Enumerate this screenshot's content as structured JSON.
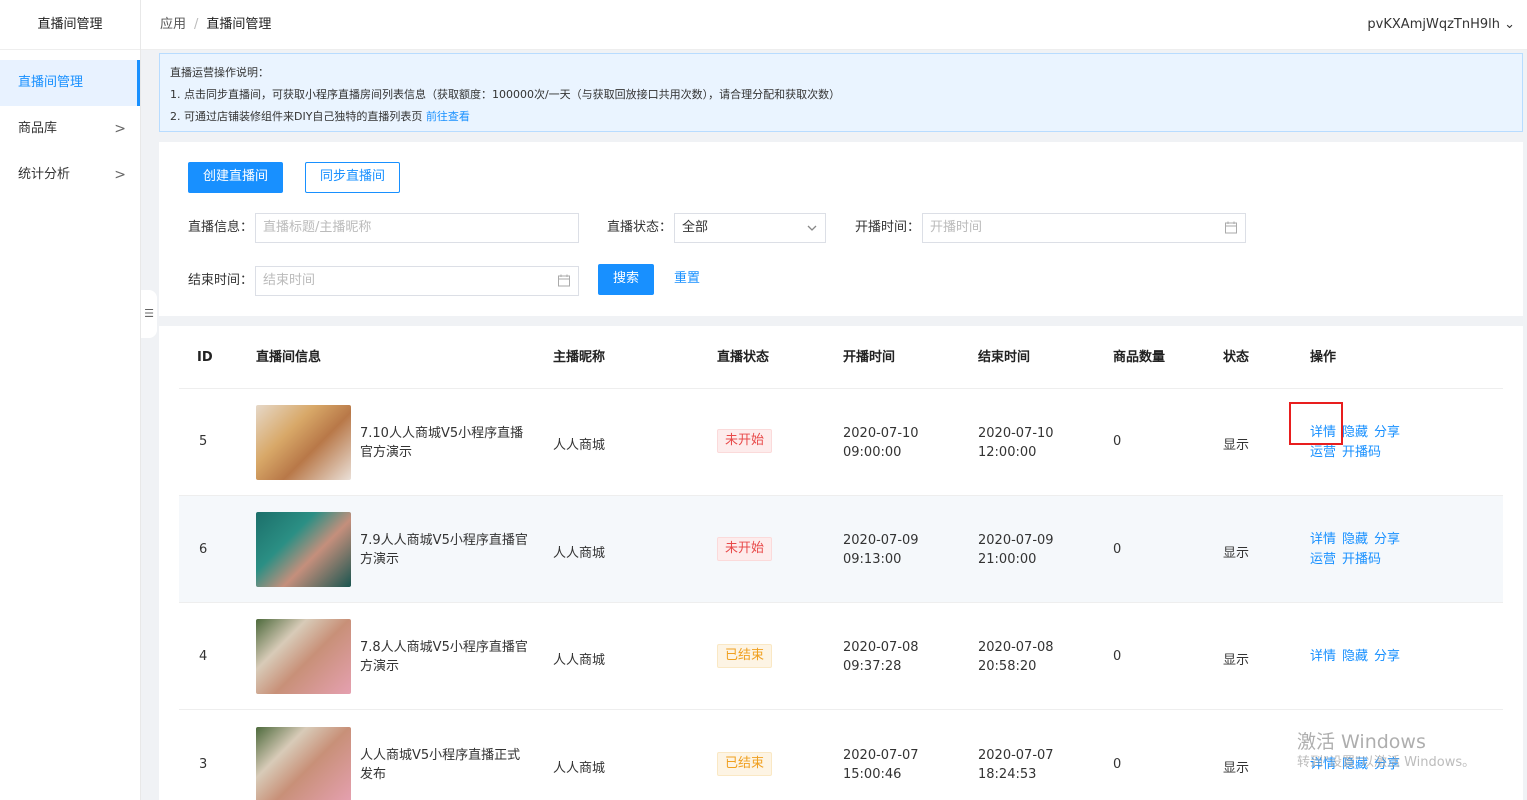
{
  "sidebar": {
    "title": "直播间管理",
    "items": [
      {
        "label": "直播间管理",
        "chevron": ""
      },
      {
        "label": "商品库",
        "chevron": ">"
      },
      {
        "label": "统计分析",
        "chevron": ">"
      }
    ],
    "collapse_glyph": "☰"
  },
  "header": {
    "breadcrumb_root": "应用",
    "breadcrumb_sep": "/",
    "breadcrumb_current": "直播间管理",
    "user": "pvKXAmjWqzTnH9lh ⌄"
  },
  "notice": {
    "title": "直播运营操作说明：",
    "line1": "1. 点击同步直播间，可获取小程序直播房间列表信息（获取额度：100000次/一天（与获取回放接口共用次数），请合理分配和获取次数）",
    "line2": "2. 可通过店铺装修组件来DIY自己独特的直播列表页",
    "line2_link": "前往查看"
  },
  "toolbar": {
    "create_label": "创建直播间",
    "sync_label": "同步直播间"
  },
  "filters": {
    "info_label": "直播信息：",
    "info_placeholder": "直播标题/主播昵称",
    "status_label": "直播状态：",
    "status_value": "全部",
    "start_label": "开播时间：",
    "start_placeholder": "开播时间",
    "end_label": "结束时间：",
    "end_placeholder": "结束时间",
    "search_label": "搜索",
    "reset_label": "重置"
  },
  "table": {
    "headers": {
      "id": "ID",
      "info": "直播间信息",
      "anchor": "主播昵称",
      "live_status": "直播状态",
      "start": "开播时间",
      "end": "结束时间",
      "goods": "商品数量",
      "state": "状态",
      "ops": "操作"
    },
    "rows": [
      {
        "id": "5",
        "title": "7.10人人商城V5小程序直播官方演示",
        "anchor": "人人商城",
        "status": "未开始",
        "start_date": "2020-07-10",
        "start_time": "09:00:00",
        "end_date": "2020-07-10",
        "end_time": "12:00:00",
        "goods": "0",
        "state": "显示",
        "ops": [
          "详情",
          "隐藏",
          "分享",
          "运营",
          "开播码"
        ]
      },
      {
        "id": "6",
        "title": "7.9人人商城V5小程序直播官方演示",
        "anchor": "人人商城",
        "status": "未开始",
        "start_date": "2020-07-09",
        "start_time": "09:13:00",
        "end_date": "2020-07-09",
        "end_time": "21:00:00",
        "goods": "0",
        "state": "显示",
        "ops": [
          "详情",
          "隐藏",
          "分享",
          "运营",
          "开播码"
        ]
      },
      {
        "id": "4",
        "title": "7.8人人商城V5小程序直播官方演示",
        "anchor": "人人商城",
        "status": "已结束",
        "start_date": "2020-07-08",
        "start_time": "09:37:28",
        "end_date": "2020-07-08",
        "end_time": "20:58:20",
        "goods": "0",
        "state": "显示",
        "ops": [
          "详情",
          "隐藏",
          "分享"
        ]
      },
      {
        "id": "3",
        "title": "人人商城V5小程序直播正式发布",
        "anchor": "人人商城",
        "status": "已结束",
        "start_date": "2020-07-07",
        "start_time": "15:00:46",
        "end_date": "2020-07-07",
        "end_time": "18:24:53",
        "goods": "0",
        "state": "显示",
        "ops": [
          "详情",
          "隐藏",
          "分享"
        ]
      }
    ]
  },
  "watermark": {
    "line1": "激活 Windows",
    "line2": "转到\"设置\"以激活 Windows。"
  },
  "colors": {
    "accent": "#1890ff",
    "danger": "#e84a4a",
    "warning": "#f0a020",
    "highlight_box": "#e81e1e"
  },
  "icons": {
    "calendar": "calendar-icon",
    "chevron_right": "chevron-right-icon",
    "chevron_down": "chevron-down-icon",
    "menu": "menu-icon"
  }
}
